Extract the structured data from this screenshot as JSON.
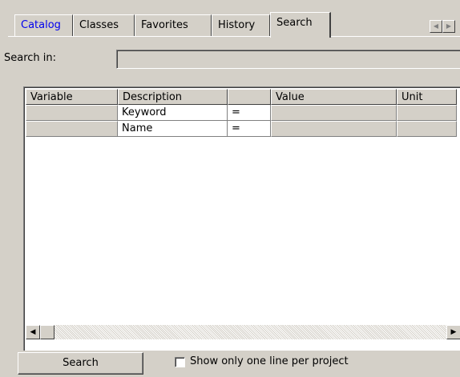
{
  "tabs": [
    {
      "label": "Catalog",
      "active": false,
      "link": true
    },
    {
      "label": "Classes",
      "active": false,
      "link": false
    },
    {
      "label": "Favorites",
      "active": false,
      "link": false
    },
    {
      "label": "History",
      "active": false,
      "link": false
    },
    {
      "label": "Search",
      "active": true,
      "link": false
    }
  ],
  "tab_scroll": {
    "left_icon": "arrow-left-icon",
    "right_icon": "arrow-right-icon"
  },
  "search_in": {
    "label": "Search in:",
    "value": ""
  },
  "table": {
    "columns": [
      "Variable",
      "Description",
      "",
      "Value",
      "Unit"
    ],
    "rows": [
      {
        "variable": "",
        "description": "Keyword",
        "op": "=",
        "value": "",
        "unit": ""
      },
      {
        "variable": "",
        "description": "Name",
        "op": "=",
        "value": "",
        "unit": ""
      }
    ]
  },
  "search_button": {
    "label": "Search"
  },
  "one_line_checkbox": {
    "label": "Show only one line per project",
    "checked": false
  },
  "colors": {
    "face": "#d4d0c8",
    "link": "#0000ee",
    "shadow": "#404040"
  }
}
